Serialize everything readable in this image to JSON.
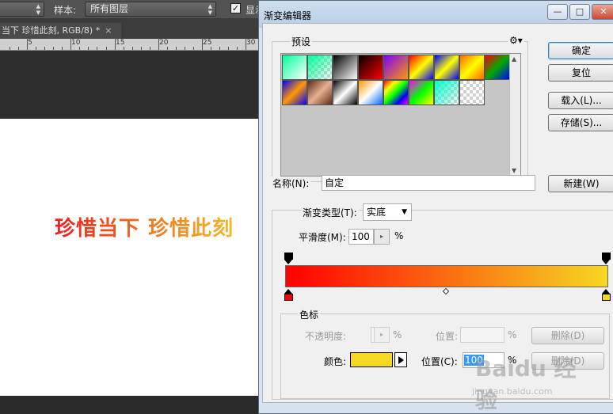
{
  "photoshop": {
    "options_bar": {
      "sample_label": "样本:",
      "sample_value": "所有图层",
      "show_checkbox_label": "显示",
      "show_checked": true
    },
    "document_tab": {
      "title": "当下 珍惜此刻, RGB/8) *",
      "close": "×"
    },
    "ruler_ticks": [
      "5",
      "10",
      "15",
      "20",
      "25",
      "30"
    ],
    "canvas_text": "珍惜当下 珍惜此刻"
  },
  "dialog": {
    "title": "渐变编辑器",
    "window_buttons": {
      "minimize": "—",
      "maximize": "□",
      "close": "✕"
    },
    "presets": {
      "label": "预设",
      "gear_icon": "gear-icon",
      "swatches": [
        [
          "#00ff99",
          "#ffffff"
        ],
        [
          "#00ff99",
          "checker"
        ],
        [
          "#000000",
          "#ffffff"
        ],
        [
          "#000000",
          "#ff0000"
        ],
        [
          "#7a00ff",
          "#ff9900"
        ],
        [
          "#ff0000",
          "#ffff00",
          "#0000ff"
        ],
        [
          "#0000ff",
          "#ffff00",
          "#0000ff"
        ],
        [
          "#ff6600",
          "#ffff00",
          "#ff6600"
        ],
        [
          "#ff0000",
          "#00aa00",
          "#0000ff"
        ],
        [
          "#0000ff",
          "#ff9900",
          "#0000ff"
        ],
        [
          "#5b2a1a",
          "#e8b090",
          "#5b2a1a"
        ],
        [
          "#000000",
          "#ffffff",
          "#000000"
        ],
        [
          "#ff9900",
          "#ffffff",
          "#0066ff"
        ],
        [
          "#ff0000",
          "#ffff00",
          "#00ff00",
          "#0000ff",
          "#ff00ff"
        ],
        [
          "#ff00ff",
          "#00ff00",
          "#ffff00"
        ],
        [
          "#00ffcc",
          "checker"
        ],
        [
          "checker",
          "checker"
        ]
      ]
    },
    "buttons": {
      "ok": "确定",
      "reset": "复位",
      "load": "载入(L)...",
      "save": "存储(S)...",
      "new": "新建(W)"
    },
    "name_label": "名称(N):",
    "name_value": "自定",
    "gradient_type_label": "渐变类型(T):",
    "gradient_type_value": "实底",
    "smoothness_label": "平滑度(M):",
    "smoothness_value": "100",
    "smoothness_unit": "%",
    "gradient": {
      "colors": [
        "#ff0000",
        "#f6d823"
      ],
      "left_stop_color": "#ff0000",
      "right_stop_color": "#f6d823"
    },
    "stops_group": {
      "label": "色标",
      "opacity_label": "不透明度:",
      "opacity_value": "",
      "opacity_unit": "%",
      "opacity_location_label": "位置:",
      "opacity_location_value": "",
      "opacity_location_unit": "%",
      "opacity_delete": "删除(D)",
      "color_label": "颜色:",
      "color_value": "#f6d823",
      "color_location_label": "位置(C):",
      "color_location_value": "100",
      "color_location_unit": "%",
      "color_delete": "删除(D)"
    }
  },
  "watermark": {
    "brand": "Baidu 经验",
    "url": "jingyan.baidu.com"
  }
}
